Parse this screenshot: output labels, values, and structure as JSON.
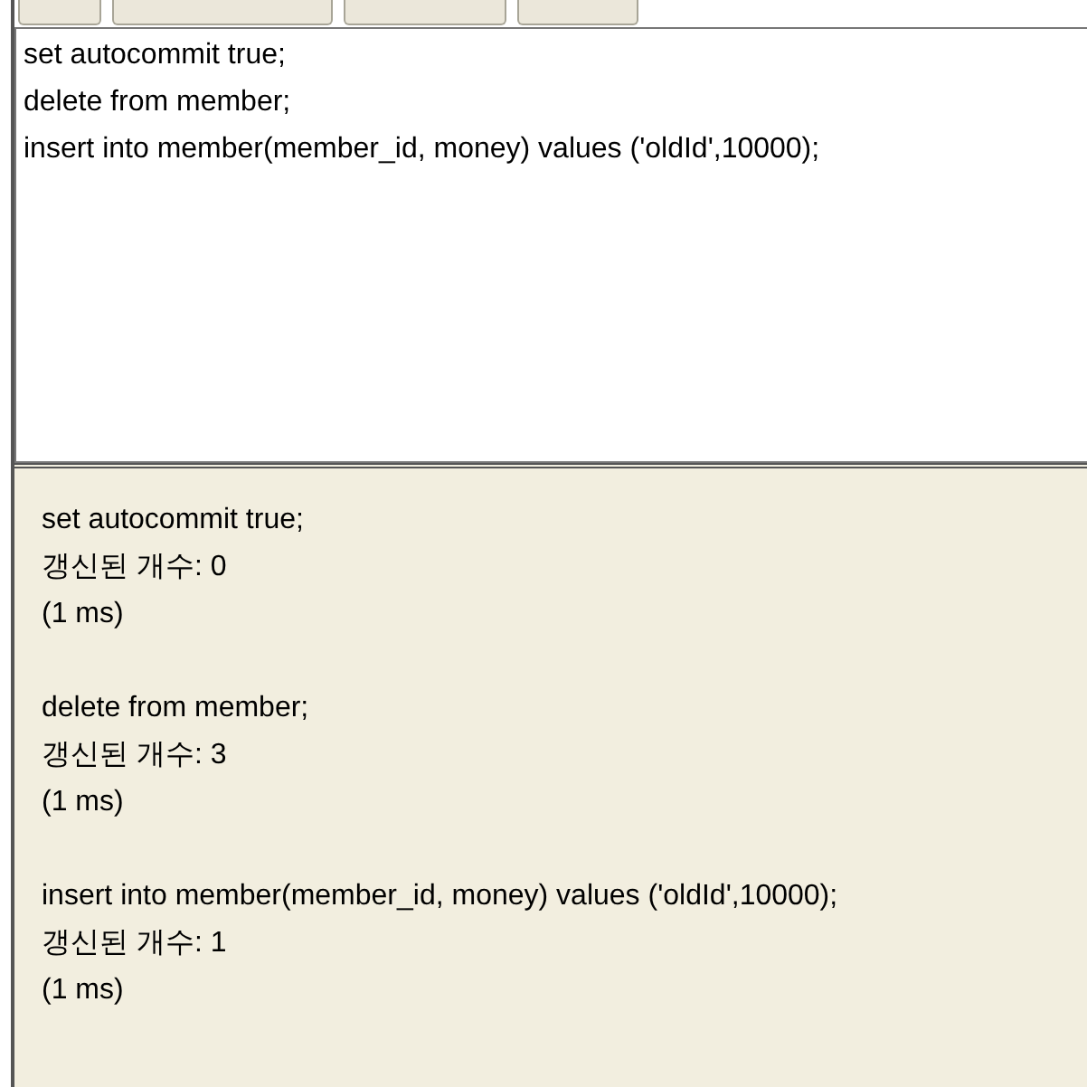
{
  "toolbar": [
    {
      "kind": "button"
    },
    {
      "kind": "button"
    },
    {
      "kind": "button"
    },
    {
      "kind": "button"
    }
  ],
  "editor": {
    "lines": [
      "set autocommit true;",
      "delete from member;",
      "insert into member(member_id, money) values ('oldId',10000);"
    ]
  },
  "results": [
    {
      "statement": "set autocommit true;",
      "updated": "갱신된 개수: 0",
      "time": "(1 ms)"
    },
    {
      "statement": "delete from member;",
      "updated": "갱신된 개수: 3",
      "time": "(1 ms)"
    },
    {
      "statement": "insert into member(member_id, money) values ('oldId',10000);",
      "updated": "갱신된 개수: 1",
      "time": "(1 ms)"
    }
  ]
}
